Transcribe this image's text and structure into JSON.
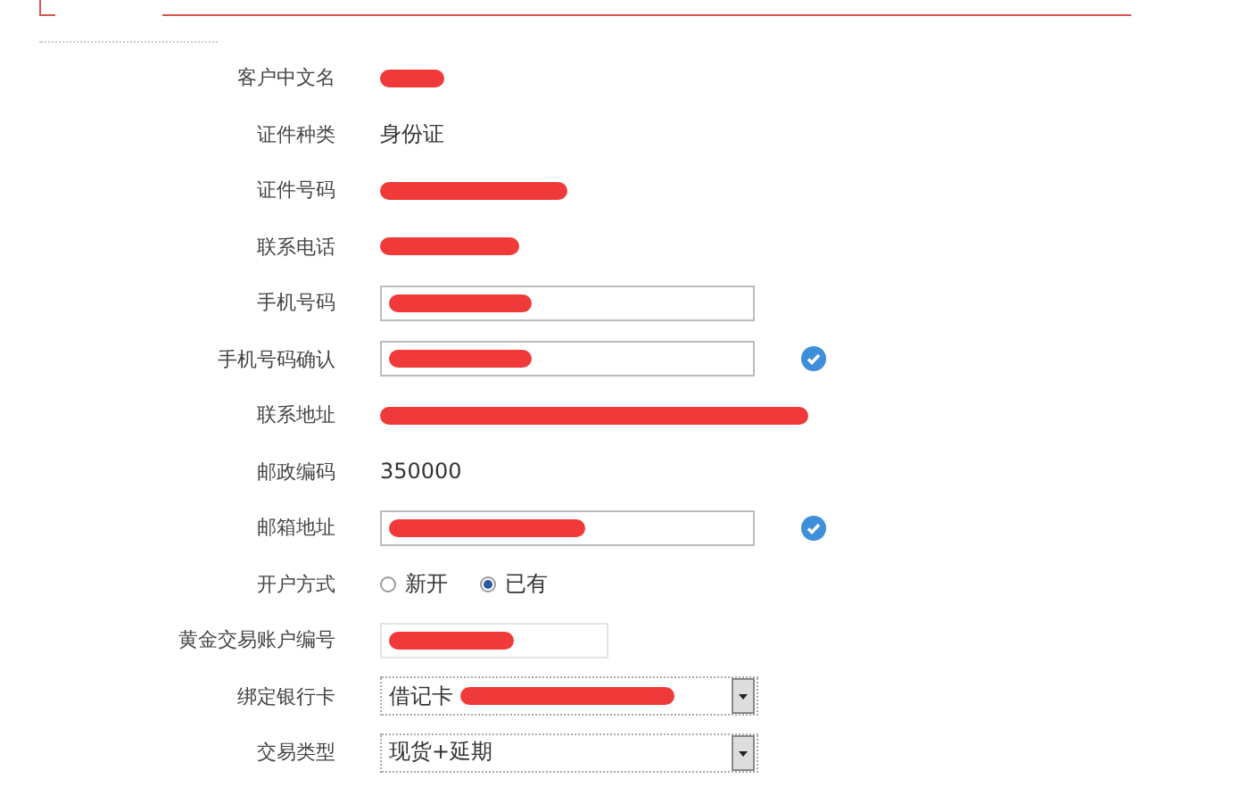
{
  "form": {
    "rows": [
      {
        "label": "客户中文名",
        "kind": "redacted"
      },
      {
        "label": "证件种类",
        "kind": "text",
        "value": "身份证"
      },
      {
        "label": "证件号码",
        "kind": "redacted"
      },
      {
        "label": "联系电话",
        "kind": "redacted"
      },
      {
        "label": "手机号码",
        "kind": "input",
        "verified": false
      },
      {
        "label": "手机号码确认",
        "kind": "input",
        "verified": true
      },
      {
        "label": "联系地址",
        "kind": "redacted"
      },
      {
        "label": "邮政编码",
        "kind": "text",
        "value": "350000"
      },
      {
        "label": "邮箱地址",
        "kind": "input",
        "verified": true
      },
      {
        "label": "开户方式",
        "kind": "radio",
        "options": [
          {
            "label": "新开",
            "selected": false
          },
          {
            "label": "已有",
            "selected": true
          }
        ]
      },
      {
        "label": "黄金交易账户编号",
        "kind": "short_input"
      },
      {
        "label": "绑定银行卡",
        "kind": "select",
        "value": "借记卡",
        "redacted": true
      },
      {
        "label": "交易类型",
        "kind": "select",
        "value": "现货+延期",
        "redacted": false
      }
    ]
  }
}
